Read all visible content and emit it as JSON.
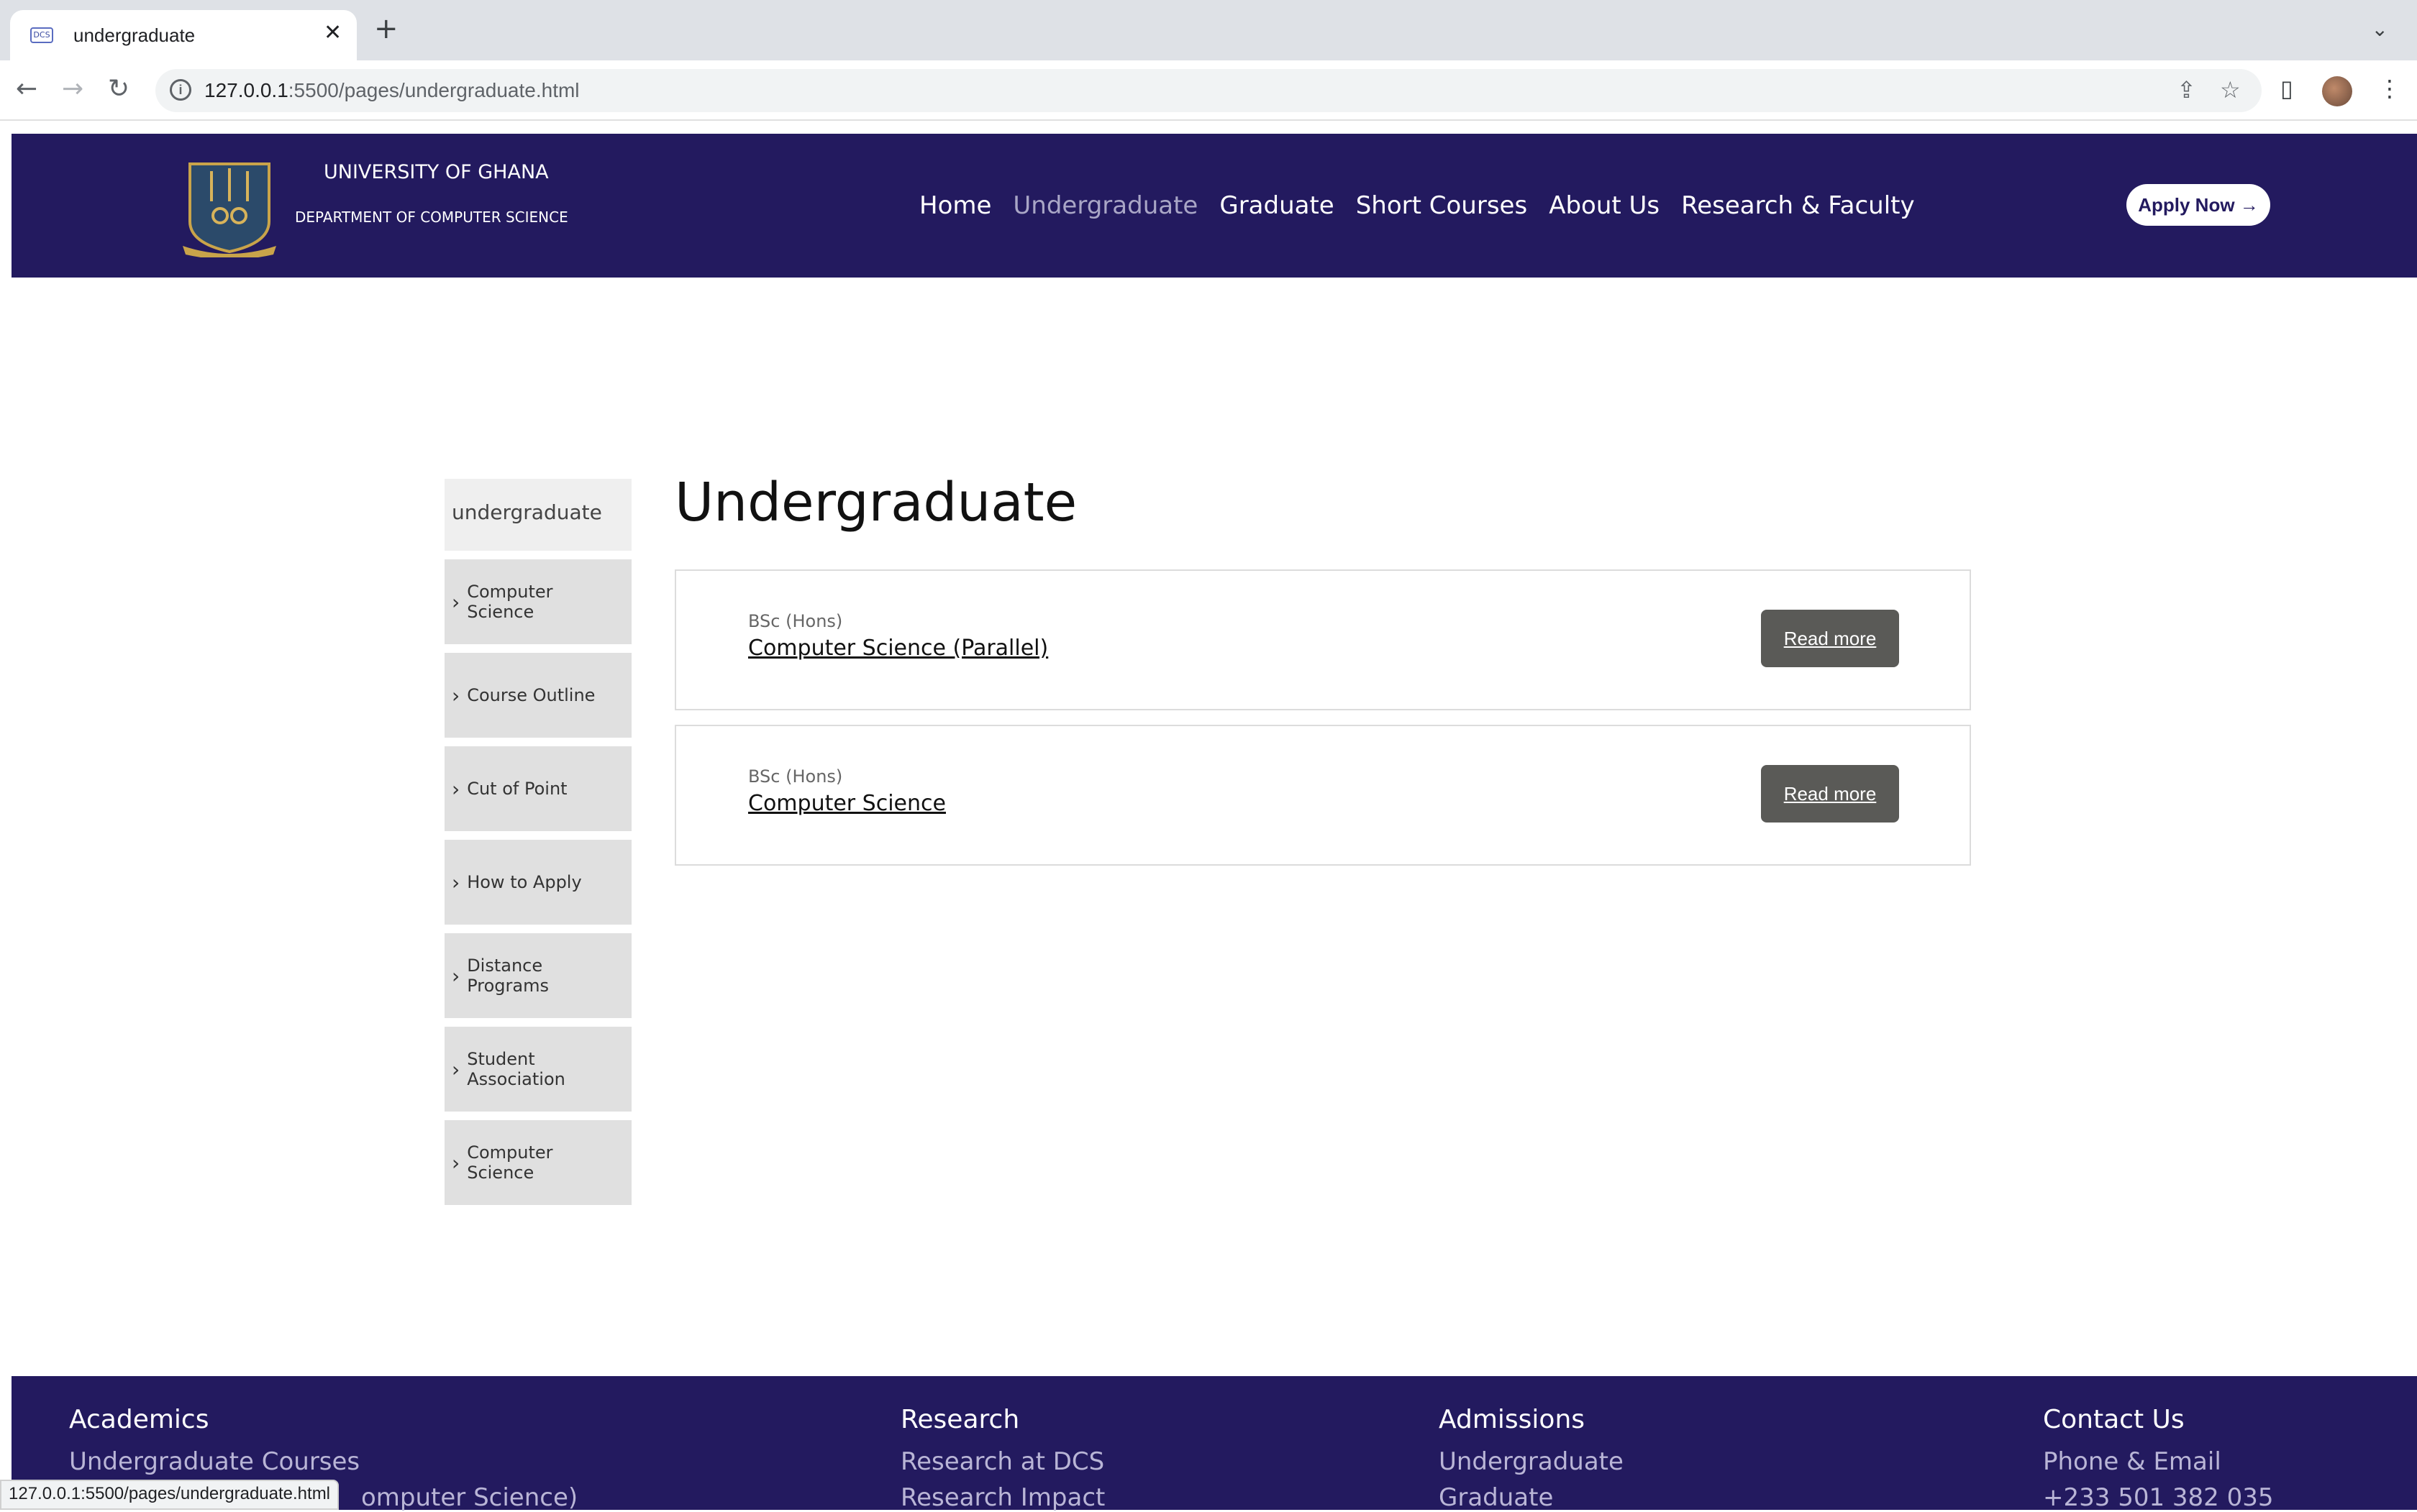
{
  "browser": {
    "tab_title": "undergraduate",
    "favicon_text": "DCS",
    "url_host": "127.0.0.1",
    "url_rest": ":5500/pages/undergraduate.html",
    "status_url": "127.0.0.1:5500/pages/undergraduate.html"
  },
  "header": {
    "university": "UNIVERSITY OF GHANA",
    "department": "DEPARTMENT OF COMPUTER SCIENCE",
    "nav": [
      "Home",
      "Undergraduate",
      "Graduate",
      "Short Courses",
      "About Us",
      "Research & Faculty"
    ],
    "active_nav": "Undergraduate",
    "apply_label": "Apply Now →"
  },
  "sidebar": {
    "heading": "undergraduate",
    "items": [
      "Computer Science",
      "Course Outline",
      "Cut of Point",
      "How to Apply",
      "Distance Programs",
      "Student Association",
      "Computer Science"
    ]
  },
  "main": {
    "title": "Undergraduate",
    "programs": [
      {
        "degree": "BSc (Hons)",
        "name": "Computer Science (Parallel)",
        "button": "Read more"
      },
      {
        "degree": "BSc (Hons)",
        "name": "Computer Science",
        "button": "Read more"
      }
    ]
  },
  "footer": {
    "academics": {
      "heading": "Academics",
      "links": [
        "Undergraduate Courses",
        "omputer Science)"
      ]
    },
    "research": {
      "heading": "Research",
      "links": [
        "Research at DCS",
        "Research Impact"
      ]
    },
    "admissions": {
      "heading": "Admissions",
      "links": [
        "Undergraduate",
        "Graduate"
      ]
    },
    "contact": {
      "heading": "Contact Us",
      "links": [
        "Phone & Email",
        "+233 501 382 035"
      ]
    }
  }
}
